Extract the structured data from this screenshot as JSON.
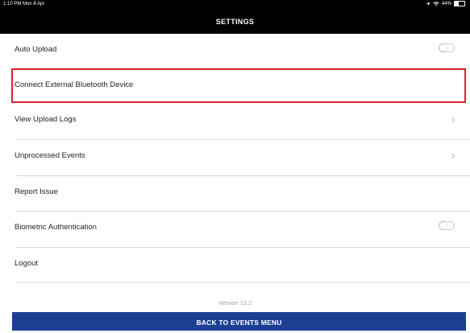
{
  "status_bar": {
    "time": "1:10 PM  Mon 8 Apr",
    "battery_text": "44%",
    "battery_level": 0.44
  },
  "header": {
    "title": "SETTINGS"
  },
  "settings": {
    "items": [
      {
        "label": "Auto Upload",
        "control": "toggle",
        "on": false
      },
      {
        "label": "Connect External Bluetooth Device",
        "control": "none",
        "highlighted": true
      },
      {
        "label": "View Upload Logs",
        "control": "chevron"
      },
      {
        "label": "Unprocessed Events",
        "control": "chevron"
      },
      {
        "label": "Report Issue",
        "control": "none"
      },
      {
        "label": "Biometric Authentication",
        "control": "toggle",
        "on": false
      },
      {
        "label": "Logout",
        "control": "none"
      }
    ]
  },
  "footer": {
    "version": "Version 12.2",
    "back_button_label": "BACK TO EVENTS MENU"
  },
  "colors": {
    "header_bg": "#000000",
    "highlight_border": "#e21f2b",
    "primary_button": "#1c3f94"
  },
  "icons": {
    "location": "location-arrow-icon",
    "wifi": "wifi-icon",
    "battery": "battery-icon",
    "chevron": "chevron-right-icon"
  }
}
